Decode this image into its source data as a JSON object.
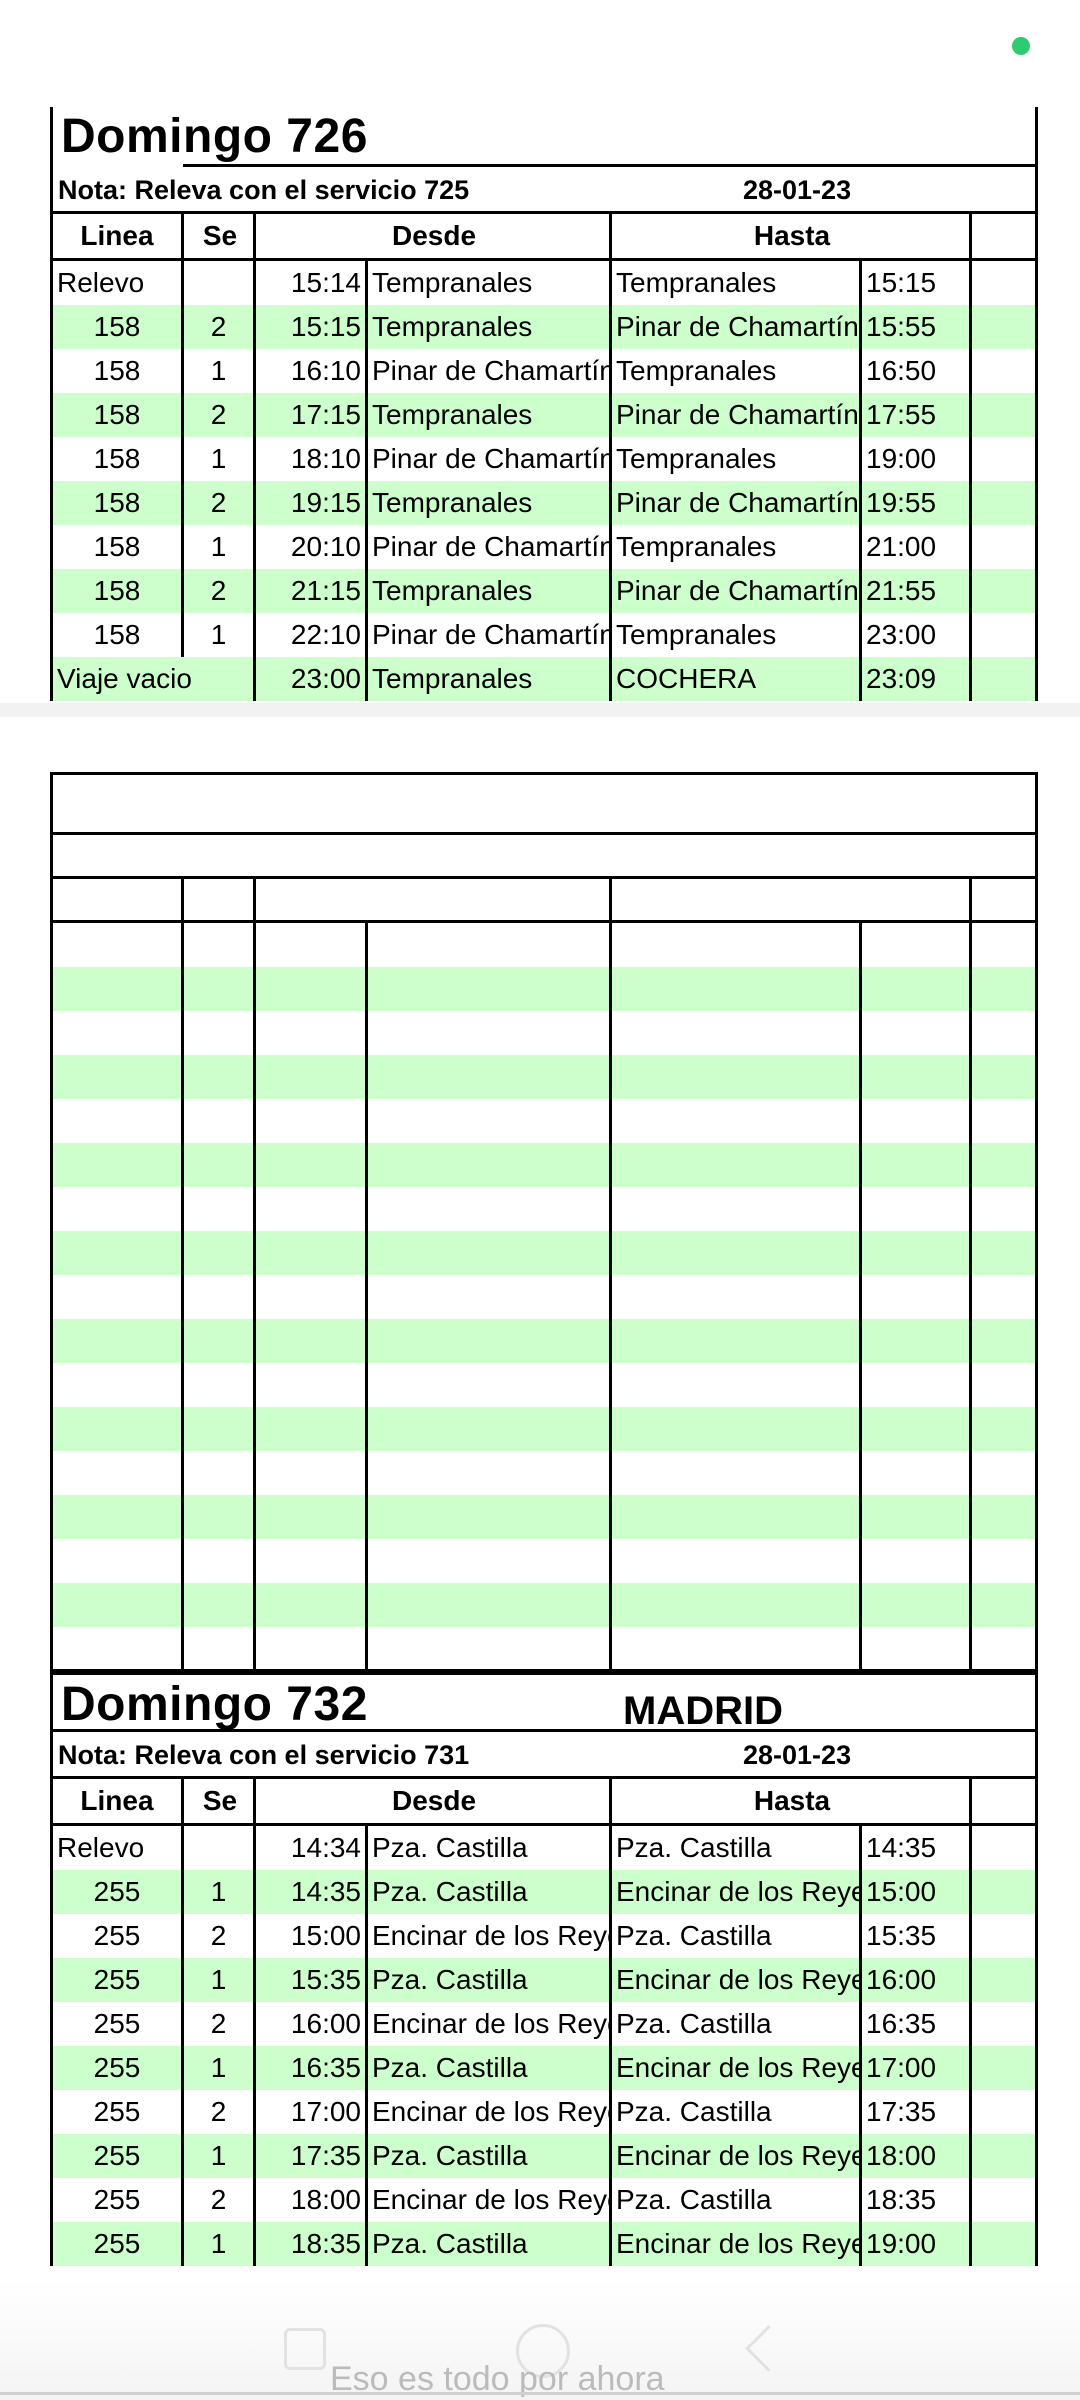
{
  "sheet1": {
    "title": "Domingo 726",
    "city": "",
    "nota": "Nota: Releva con el servicio 725",
    "date": "28-01-23",
    "headers": {
      "linea": "Linea",
      "se": "Se",
      "desde": "Desde",
      "hasta": "Hasta"
    },
    "rows": [
      {
        "linea": "Relevo",
        "se": "",
        "time1": "15:14",
        "desde": "Tempranales",
        "hasta": "Tempranales",
        "time2": "15:15"
      },
      {
        "linea": "158",
        "se": "2",
        "time1": "15:15",
        "desde": "Tempranales",
        "hasta": "Pinar de Chamartín",
        "time2": "15:55"
      },
      {
        "linea": "158",
        "se": "1",
        "time1": "16:10",
        "desde": "Pinar de Chamartín",
        "hasta": "Tempranales",
        "time2": "16:50"
      },
      {
        "linea": "158",
        "se": "2",
        "time1": "17:15",
        "desde": "Tempranales",
        "hasta": "Pinar de Chamartín",
        "time2": "17:55"
      },
      {
        "linea": "158",
        "se": "1",
        "time1": "18:10",
        "desde": "Pinar de Chamartín",
        "hasta": "Tempranales",
        "time2": "19:00"
      },
      {
        "linea": "158",
        "se": "2",
        "time1": "19:15",
        "desde": "Tempranales",
        "hasta": "Pinar de Chamartín",
        "time2": "19:55"
      },
      {
        "linea": "158",
        "se": "1",
        "time1": "20:10",
        "desde": "Pinar de Chamartín",
        "hasta": "Tempranales",
        "time2": "21:00"
      },
      {
        "linea": "158",
        "se": "2",
        "time1": "21:15",
        "desde": "Tempranales",
        "hasta": "Pinar de Chamartín",
        "time2": "21:55"
      },
      {
        "linea": "158",
        "se": "1",
        "time1": "22:10",
        "desde": "Pinar de Chamartín",
        "hasta": "Tempranales",
        "time2": "23:00"
      },
      {
        "linea": "Viaje vacio",
        "se": "",
        "time1": "23:00",
        "desde": "Tempranales",
        "hasta": "COCHERA",
        "time2": "23:09"
      }
    ]
  },
  "sheet2": {
    "title": "Domingo 732",
    "city": "MADRID",
    "nota": "Nota: Releva con el servicio 731",
    "date": "28-01-23",
    "headers": {
      "linea": "Linea",
      "se": "Se",
      "desde": "Desde",
      "hasta": "Hasta"
    },
    "rows": [
      {
        "linea": "Relevo",
        "se": "",
        "time1": "14:34",
        "desde": "Pza. Castilla",
        "hasta": "Pza. Castilla",
        "time2": "14:35"
      },
      {
        "linea": "255",
        "se": "1",
        "time1": "14:35",
        "desde": "Pza. Castilla",
        "hasta": "Encinar de los Reyes",
        "time2": "15:00"
      },
      {
        "linea": "255",
        "se": "2",
        "time1": "15:00",
        "desde": "Encinar de los Reyes",
        "hasta": "Pza. Castilla",
        "time2": "15:35"
      },
      {
        "linea": "255",
        "se": "1",
        "time1": "15:35",
        "desde": "Pza. Castilla",
        "hasta": "Encinar de los Reyes",
        "time2": "16:00"
      },
      {
        "linea": "255",
        "se": "2",
        "time1": "16:00",
        "desde": "Encinar de los Reyes",
        "hasta": "Pza. Castilla",
        "time2": "16:35"
      },
      {
        "linea": "255",
        "se": "1",
        "time1": "16:35",
        "desde": "Pza. Castilla",
        "hasta": "Encinar de los Reyes",
        "time2": "17:00"
      },
      {
        "linea": "255",
        "se": "2",
        "time1": "17:00",
        "desde": "Encinar de los Reyes",
        "hasta": "Pza. Castilla",
        "time2": "17:35"
      },
      {
        "linea": "255",
        "se": "1",
        "time1": "17:35",
        "desde": "Pza. Castilla",
        "hasta": "Encinar de los Reyes",
        "time2": "18:00"
      },
      {
        "linea": "255",
        "se": "2",
        "time1": "18:00",
        "desde": "Encinar de los Reyes",
        "hasta": "Pza. Castilla",
        "time2": "18:35"
      },
      {
        "linea": "255",
        "se": "1",
        "time1": "18:35",
        "desde": "Pza. Castilla",
        "hasta": "Encinar de los Reyes",
        "time2": "19:00"
      }
    ]
  },
  "empty_sheet": {
    "rows": 17
  },
  "footer": {
    "message": "Eso es todo por ahora"
  },
  "colors": {
    "row_alt": "#ccffcc",
    "status_dot": "#2ecc71"
  }
}
